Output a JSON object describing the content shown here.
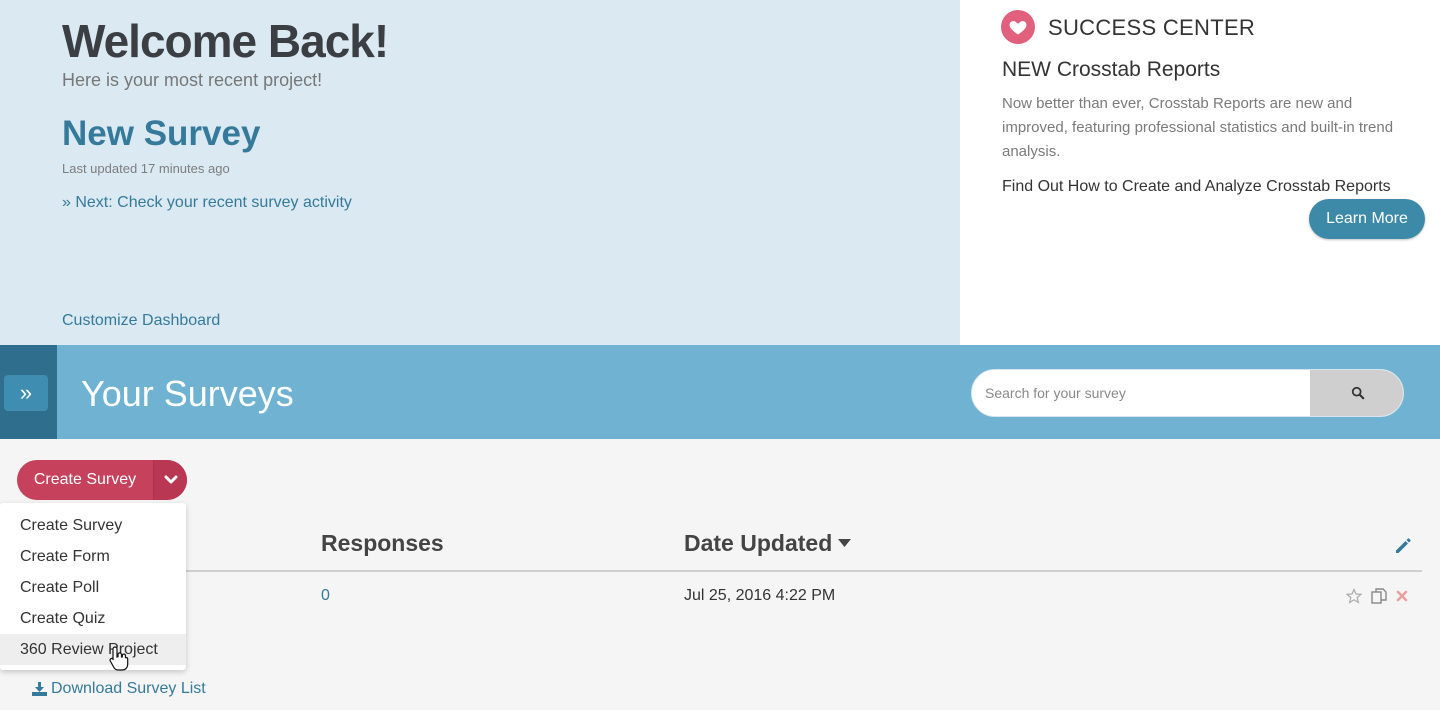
{
  "welcome": {
    "title": "Welcome Back!",
    "subtitle": "Here is your most recent project!",
    "project_title": "New Survey",
    "project_updated": "Last updated 17 minutes ago",
    "next_link": "» Next: Check your recent survey activity",
    "customize_link": "Customize Dashboard"
  },
  "success_center": {
    "title": "SUCCESS CENTER",
    "news_title": "NEW Crosstab Reports",
    "news_body": "Now better than ever, Crosstab Reports are new and improved, featuring professional statistics and built-in trend analysis.",
    "news_link": "Find Out How to Create and Analyze Crosstab Reports",
    "learn_more": "Learn More"
  },
  "surveys_band": {
    "expand_glyph": "»",
    "title": "Your Surveys",
    "search_placeholder": "Search for your survey"
  },
  "create_button": {
    "label": "Create Survey"
  },
  "dropdown": {
    "items": [
      "Create Survey",
      "Create Form",
      "Create Poll",
      "Create Quiz",
      "360 Review Project"
    ]
  },
  "table": {
    "headers": {
      "responses": "Responses",
      "date_updated": "Date Updated"
    },
    "rows": [
      {
        "responses": "0",
        "date_updated": "Jul 25, 2016 4:22 PM"
      }
    ]
  },
  "download_link": "Download Survey List",
  "colors": {
    "accent_blue": "#357a9a",
    "band_blue": "#6fb2d2",
    "create_red": "#c6415c",
    "heart_pink": "#e0607e"
  }
}
